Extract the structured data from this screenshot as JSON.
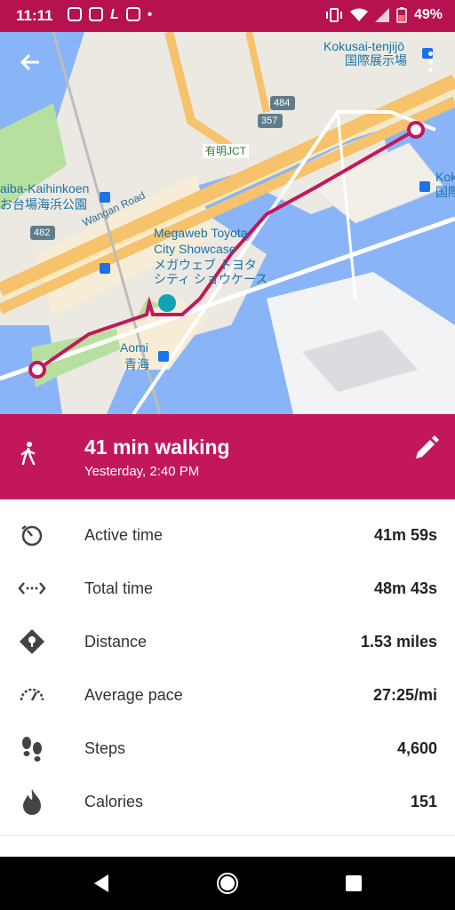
{
  "status_bar": {
    "time": "11:11",
    "battery": "49%",
    "icons": [
      "instagram-icon",
      "instagram-icon",
      "l-app-icon",
      "maps-icon",
      "dot-icon",
      "vibrate-icon",
      "wifi-icon",
      "signal-icon",
      "battery-icon"
    ]
  },
  "map": {
    "labels": {
      "kokusai_en": "Kokusai-tenjijō",
      "kokusai_jp": "国際展示場",
      "kok_partial": "Kok",
      "kok_partial_jp": "国際",
      "odaiba_en": "aiba-Kaihinkoen",
      "odaiba_jp": "お台場海浜公園",
      "wangan": "Wangan Road",
      "route_482": "482",
      "route_484": "484",
      "route_357": "357",
      "ariake_jct": "有明JCT",
      "megaweb_en_1": "Megaweb Toyota",
      "megaweb_en_2": "City Showcase",
      "megaweb_jp_1": "メガウェブ トヨタ",
      "megaweb_jp_2": "シティ ショウケース",
      "aomi_en": "Aomi",
      "aomi_jp": "青海"
    }
  },
  "activity": {
    "title": "41 min walking",
    "subtitle": "Yesterday, 2:40 PM",
    "icon": "walking-icon"
  },
  "stats": [
    {
      "label": "Active time",
      "value": "41m 59s",
      "icon": "timer-icon"
    },
    {
      "label": "Total time",
      "value": "48m 43s",
      "icon": "total-time-icon"
    },
    {
      "label": "Distance",
      "value": "1.53 miles",
      "icon": "distance-icon"
    },
    {
      "label": "Average pace",
      "value": "27:25/mi",
      "icon": "speedometer-icon"
    },
    {
      "label": "Steps",
      "value": "4,600",
      "icon": "footsteps-icon"
    },
    {
      "label": "Calories",
      "value": "151",
      "icon": "flame-icon"
    }
  ],
  "colors": {
    "accent": "#c2185b",
    "status_bar": "#b5124f",
    "route": "#c2185b",
    "water": "#8ab4f8",
    "park": "#b7dfa0"
  }
}
